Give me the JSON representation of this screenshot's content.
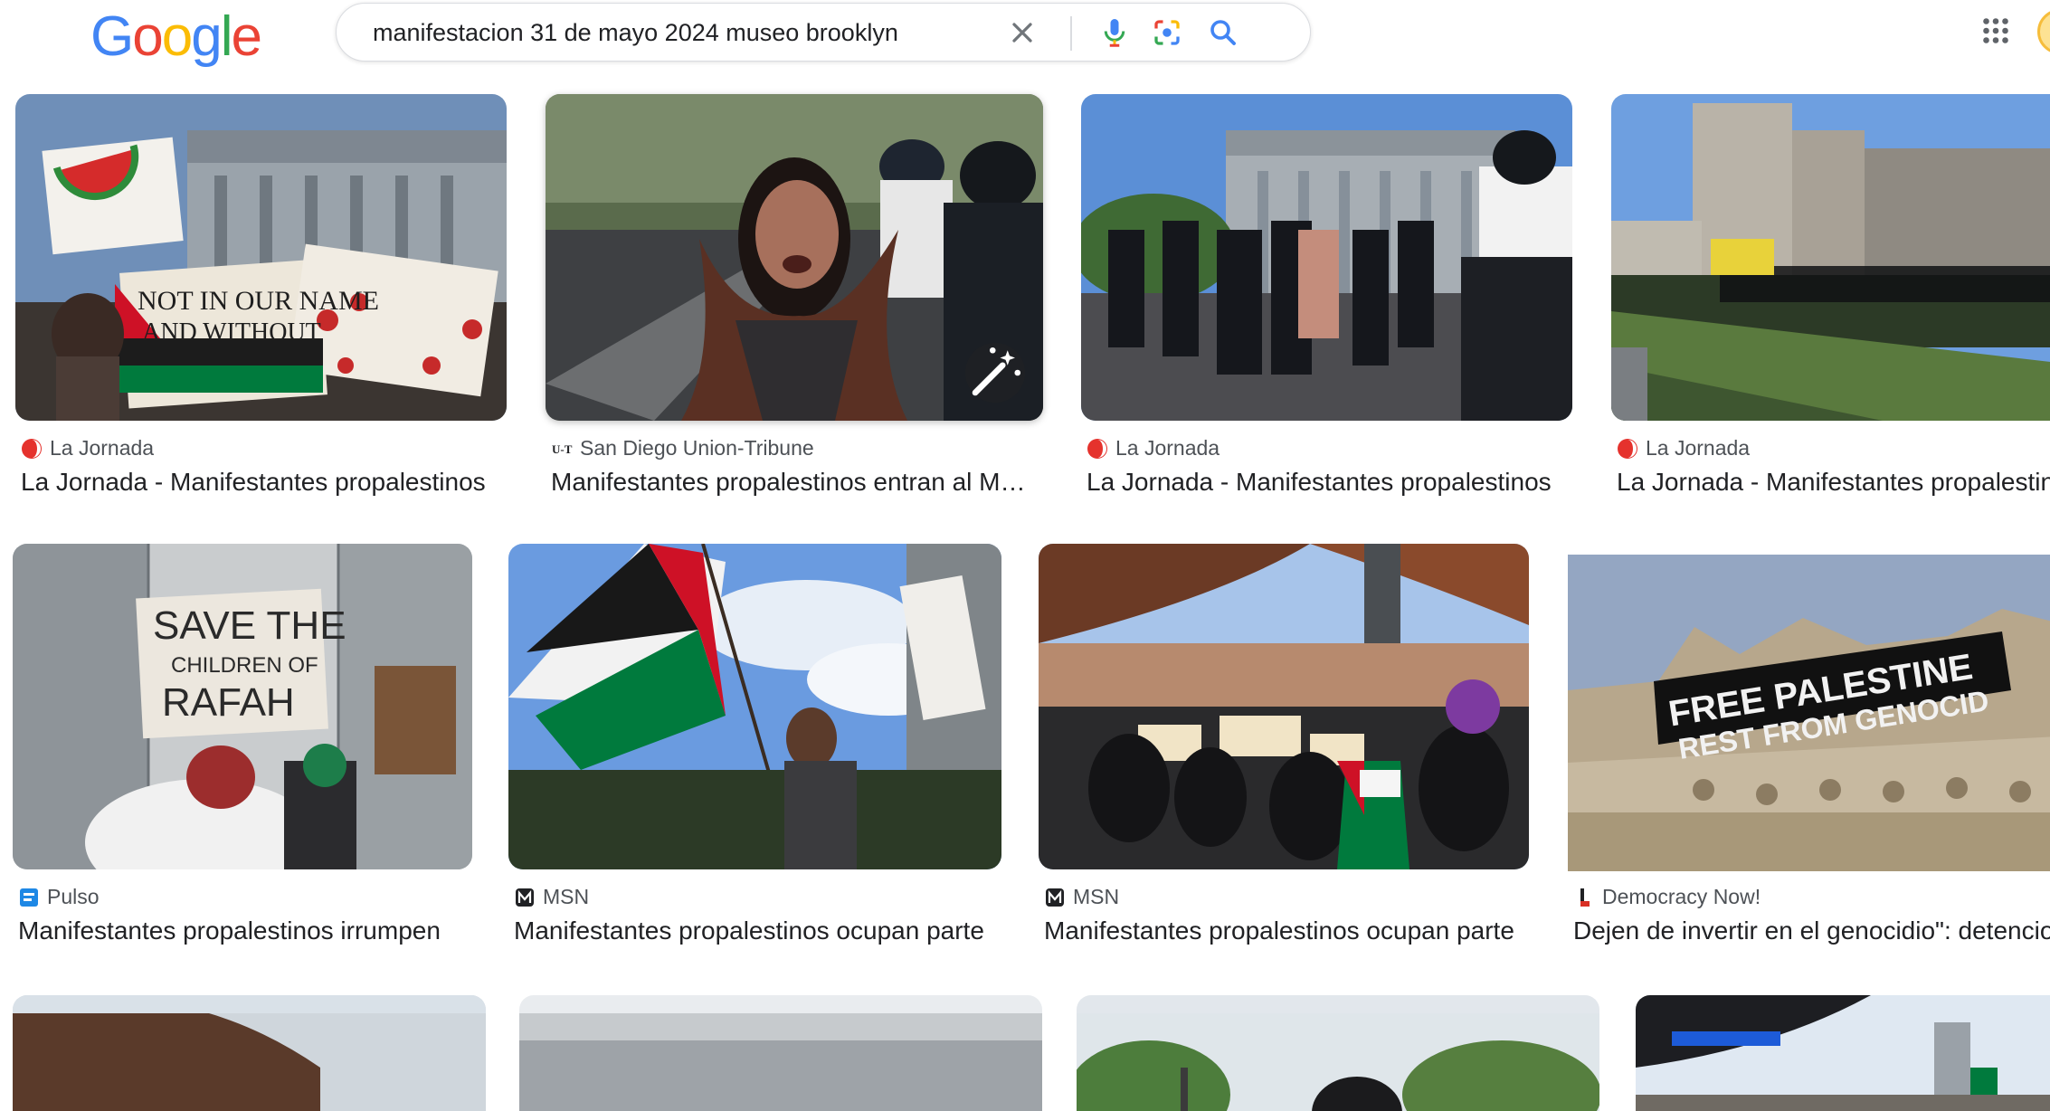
{
  "header": {
    "logo_letters": [
      {
        "ch": "G",
        "color": "#4285F4"
      },
      {
        "ch": "o",
        "color": "#EA4335"
      },
      {
        "ch": "o",
        "color": "#FBBC05"
      },
      {
        "ch": "g",
        "color": "#4285F4"
      },
      {
        "ch": "l",
        "color": "#34A853"
      },
      {
        "ch": "e",
        "color": "#EA4335"
      }
    ],
    "search_query": "manifestacion 31 de mayo 2024 museo brooklyn",
    "icons": [
      "close-icon",
      "microphone-icon",
      "google-lens-icon",
      "search-icon",
      "apps-grid-icon"
    ]
  },
  "results": [
    {
      "source": "La Jornada",
      "title": "La Jornada - Manifestantes propalestinos",
      "favicon": "la-jornada-favicon"
    },
    {
      "source": "San Diego Union-Tribune",
      "title": "Manifestantes propalestinos entran al Museo",
      "favicon": "san-diego-union-tribune-favicon"
    },
    {
      "source": "La Jornada",
      "title": "La Jornada - Manifestantes propalestinos",
      "favicon": "la-jornada-favicon"
    },
    {
      "source": "La Jornada",
      "title": "La Jornada - Manifestantes propalestinos",
      "favicon": "la-jornada-favicon"
    },
    {
      "source": "Pulso",
      "title": "Manifestantes propalestinos irrumpen",
      "favicon": "pulso-favicon"
    },
    {
      "source": "MSN",
      "title": "Manifestantes propalestinos ocupan parte",
      "favicon": "msn-favicon"
    },
    {
      "source": "MSN",
      "title": "Manifestantes propalestinos ocupan parte",
      "favicon": "msn-favicon"
    },
    {
      "source": "Democracy Now!",
      "title": "Dejen de invertir en el genocidio\": detenciones",
      "favicon": "democracy-now-favicon"
    }
  ],
  "image_text": {
    "sign_save": "SAVE THE",
    "sign_children": "CHILDREN OF",
    "sign_rafah": "RAFAH",
    "banner_line1": "FREE PALESTINE",
    "banner_line2": "REST FROM GENOCID",
    "sign_not_in_our_name": "NOT IN OUR NAME",
    "sign_and_without": "AND WITHOUT"
  },
  "colors": {
    "accent_blue": "#1a73e8",
    "palestine_red": "#ce1126",
    "palestine_green": "#007a3d"
  }
}
